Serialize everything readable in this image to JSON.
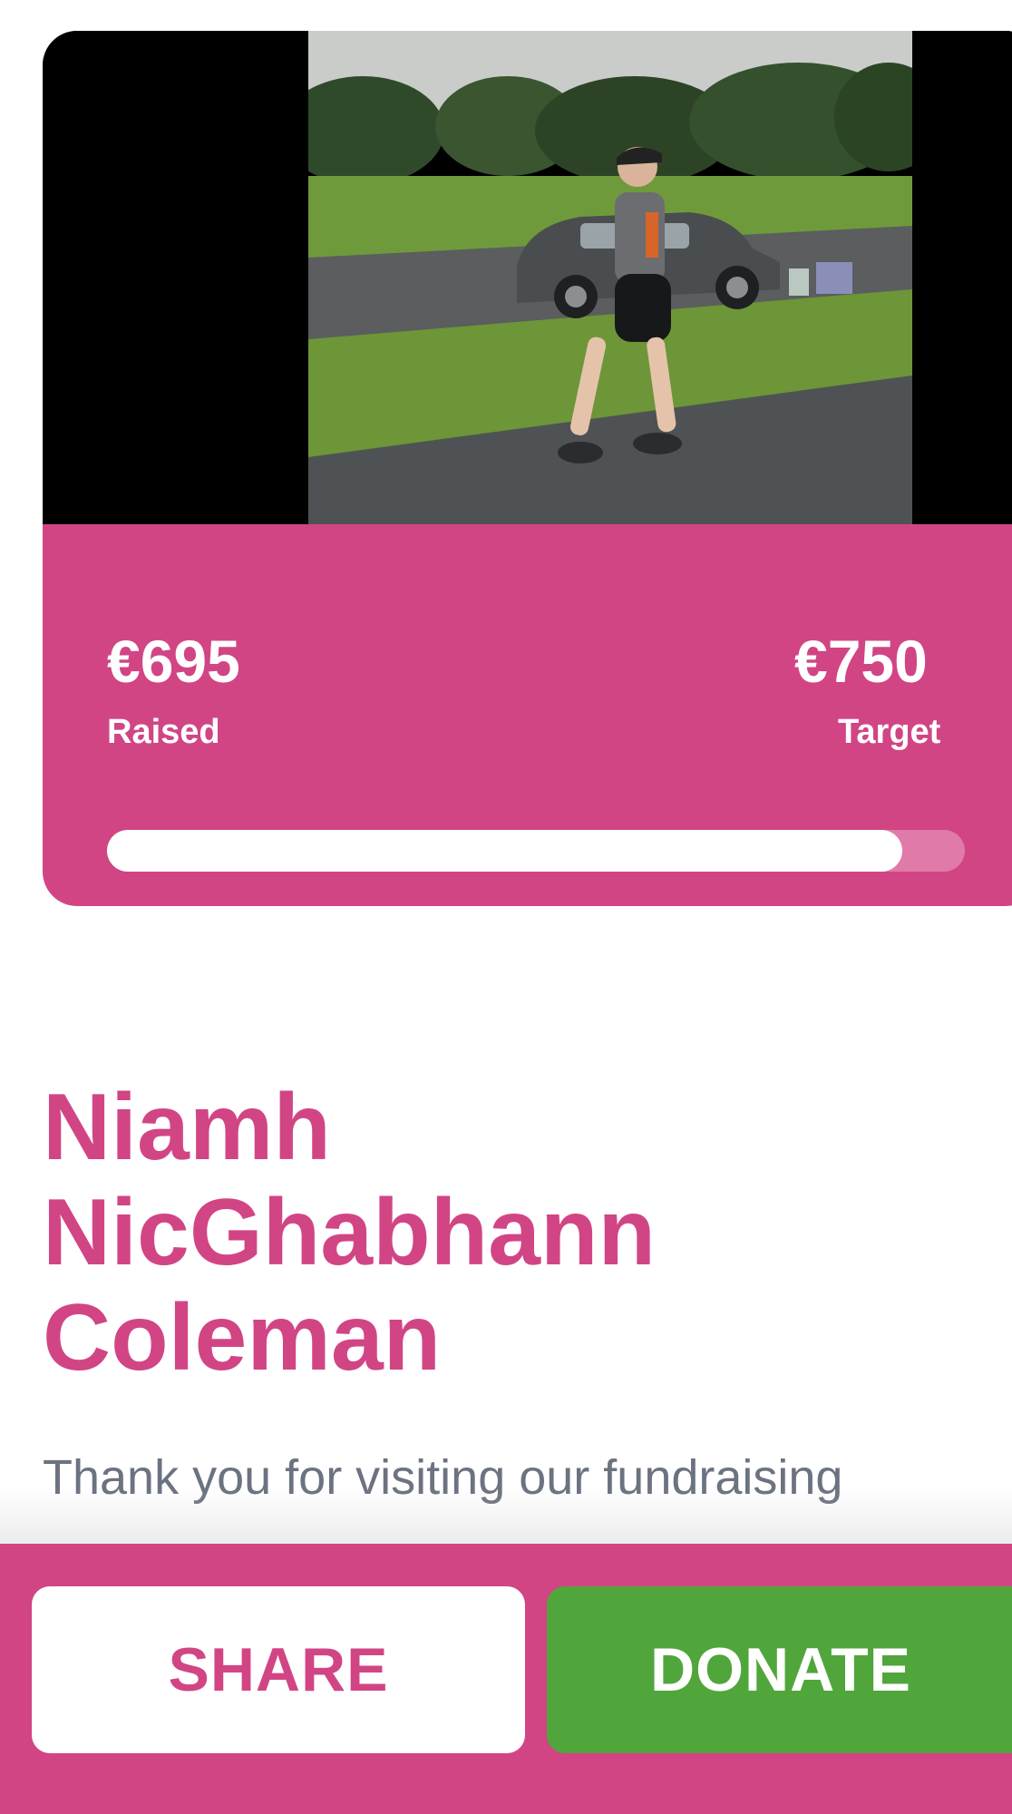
{
  "campaign": {
    "raised_amount": "€695",
    "raised_label": "Raised",
    "target_amount": "€750",
    "target_label": "Target",
    "progress_fraction": 0.927
  },
  "profile": {
    "name_line1": "Niamh",
    "name_line2": "NicGhabhann",
    "name_line3": "Coleman",
    "intro_text": "Thank you for visiting our fundraising"
  },
  "actions": {
    "share_label": "SHARE",
    "donate_label": "DONATE"
  },
  "colors": {
    "brand_pink": "#d14585",
    "donate_green": "#50a63b",
    "text_gray": "#6b7280"
  }
}
